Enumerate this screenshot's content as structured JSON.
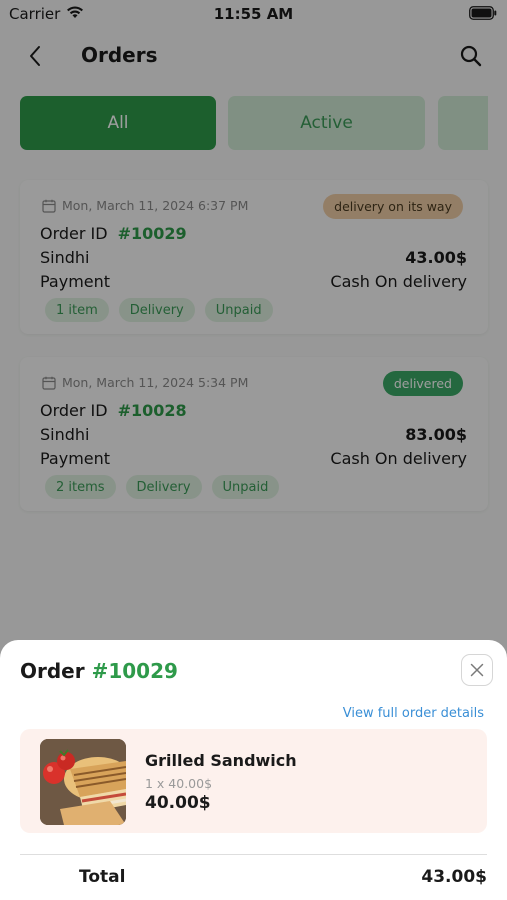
{
  "status_bar": {
    "carrier": "Carrier",
    "time": "11:55 AM"
  },
  "header": {
    "title": "Orders"
  },
  "tabs": [
    {
      "label": "All",
      "selected": true
    },
    {
      "label": "Active",
      "selected": false
    },
    {
      "label": "",
      "selected": false
    }
  ],
  "orders": [
    {
      "date": "Mon, March 11, 2024 6:37 PM",
      "status": "delivery on its way",
      "id_label": "Order ID",
      "id": "#10029",
      "customer": "Sindhi",
      "amount": "43.00$",
      "payment_label": "Payment",
      "payment_method": "Cash On delivery",
      "tags": [
        "1 item",
        "Delivery",
        "Unpaid"
      ]
    },
    {
      "date": "Mon, March 11, 2024 5:34 PM",
      "status": "delivered",
      "id_label": "Order ID",
      "id": "#10028",
      "customer": "Sindhi",
      "amount": "83.00$",
      "payment_label": "Payment",
      "payment_method": "Cash On delivery",
      "tags": [
        "2 items",
        "Delivery",
        "Unpaid"
      ]
    }
  ],
  "sheet": {
    "title_prefix": "Order ",
    "title_number": "#10029",
    "view_link": "View full order details",
    "item": {
      "name": "Grilled Sandwich",
      "qty": "1 x 40.00$",
      "price": "40.00$"
    },
    "total_label": "Total",
    "total_value": "43.00$"
  },
  "colors": {
    "accent": "#2e9a4a",
    "tab_inactive": "#cfe9d4",
    "link": "#3a8fd6",
    "status_onway": "#eecca5",
    "status_delivered": "#3ba866",
    "item_card_bg": "#fdf1ed"
  }
}
